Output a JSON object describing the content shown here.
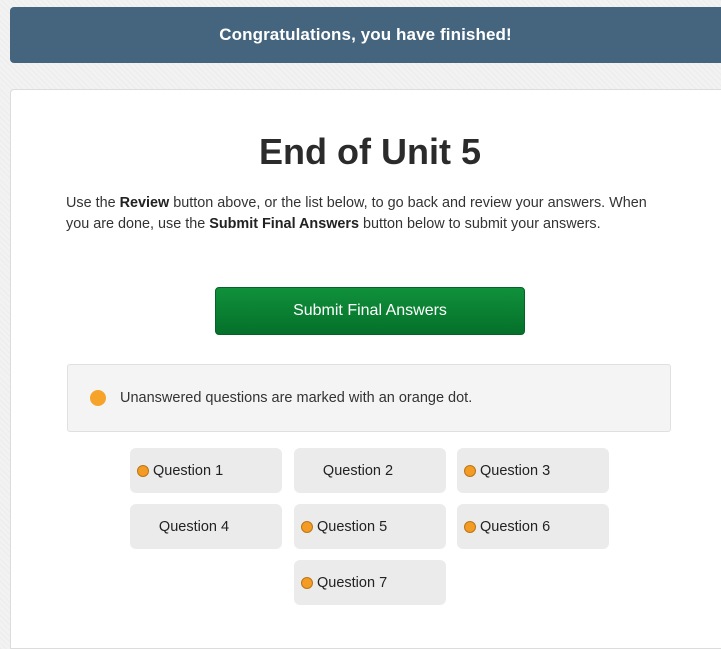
{
  "banner": {
    "text": "Congratulations, you have finished!"
  },
  "main": {
    "title": "End of Unit 5",
    "instructions": {
      "part1": "Use the ",
      "review_label": "Review",
      "part2": " button above, or the list below, to go back and review your answers. When you are done, use the ",
      "submit_label": "Submit Final Answers",
      "part3": " button below to submit your answers."
    },
    "submit_button": "Submit Final Answers",
    "legend": {
      "text": "Unanswered questions are marked with an orange dot.",
      "dot_color": "#f6a32a"
    },
    "questions": [
      {
        "label": "Question 1",
        "unanswered": true
      },
      {
        "label": "Question 2",
        "unanswered": false
      },
      {
        "label": "Question 3",
        "unanswered": true
      },
      {
        "label": "Question 4",
        "unanswered": false
      },
      {
        "label": "Question 5",
        "unanswered": true
      },
      {
        "label": "Question 6",
        "unanswered": true
      },
      {
        "label": "Question 7",
        "unanswered": true
      }
    ]
  },
  "colors": {
    "banner_bg": "#45657e",
    "submit_green": "#0a7f31",
    "orange_dot": "#f39b22"
  }
}
